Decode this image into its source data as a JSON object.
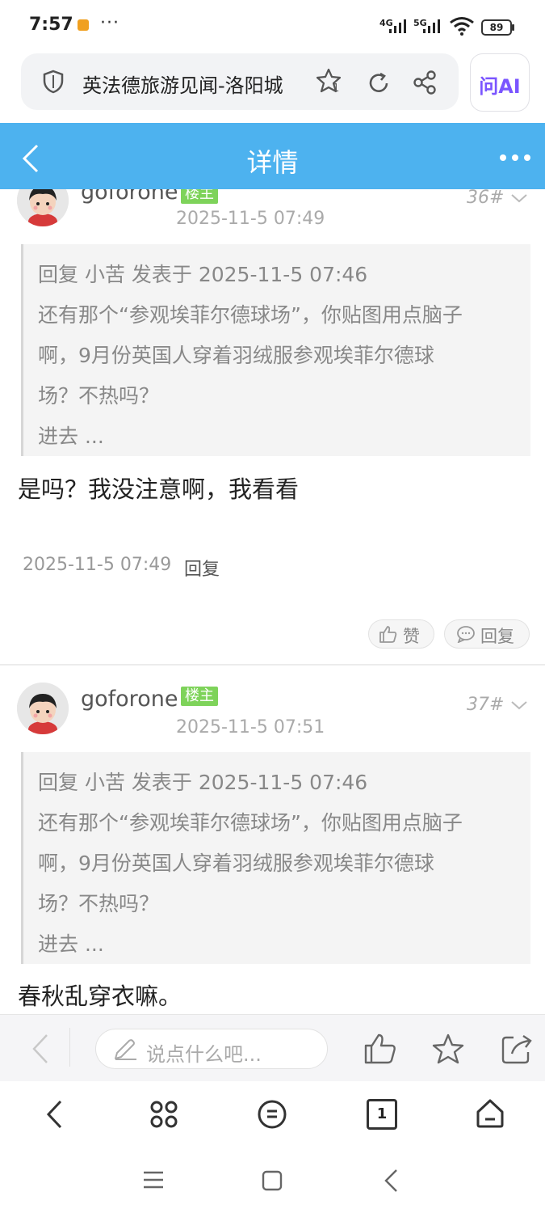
{
  "status_bar": {
    "time": "7:57",
    "dots": "···",
    "network_4g": "4G",
    "network_5g": "5G",
    "battery": "89"
  },
  "browser": {
    "url_title": "英法德旅游见闻-洛阳城",
    "tab_badge": "1",
    "ai_label": "问AI"
  },
  "header": {
    "title": "详情"
  },
  "posts": [
    {
      "username": "goforone",
      "badge": "楼主",
      "floor": "36#",
      "date": "2025-11-5 07:49",
      "quote": {
        "header": "回复 小苦 发表于 2025-11-5 07:46",
        "lines": [
          "还有那个“参观埃菲尔德球场”，你贴图用点脑子",
          "啊，9月份英国人穿着羽绒服参观埃菲尔德球",
          "场？不热吗？",
          "进去 ..."
        ]
      },
      "content": "是吗？我没注意啊，我看看",
      "meta_date": "2025-11-5 07:49",
      "reply_link": "回复",
      "like_label": "赞",
      "reply_label": "回复"
    },
    {
      "username": "goforone",
      "badge": "楼主",
      "floor": "37#",
      "date": "2025-11-5 07:51",
      "quote": {
        "header": "回复 小苦 发表于 2025-11-5 07:46",
        "lines": [
          "还有那个“参观埃菲尔德球场”，你贴图用点脑子",
          "啊，9月份英国人穿着羽绒服参观埃菲尔德球",
          "场？不热吗？",
          "进去 ..."
        ]
      },
      "content": "春秋乱穿衣嘛。"
    }
  ],
  "comment_bar": {
    "placeholder": "说点什么吧..."
  },
  "nav_bar": {
    "tab_count": "1"
  }
}
